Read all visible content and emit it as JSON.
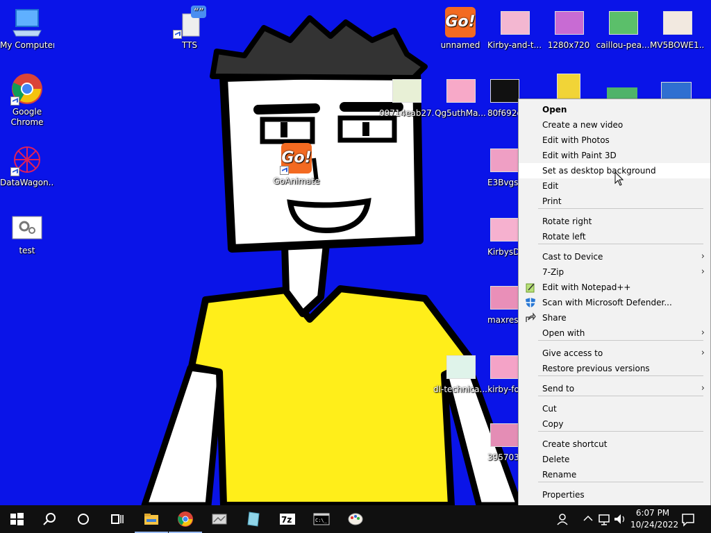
{
  "desktop_icons": [
    {
      "id": "my-computer",
      "label": "My Computer"
    },
    {
      "id": "google-chrome",
      "label": "Google\nChrome"
    },
    {
      "id": "datawagon",
      "label": "DataWagon..."
    },
    {
      "id": "test",
      "label": "test"
    },
    {
      "id": "tts",
      "label": "TTS"
    },
    {
      "id": "goanimate",
      "label": "GoAnimate"
    },
    {
      "id": "0971",
      "label": "09714eab27..."
    },
    {
      "id": "unnamed",
      "label": "unnamed"
    },
    {
      "id": "qg5uth",
      "label": "Qg5uthMa..."
    },
    {
      "id": "80f692",
      "label": "80f692c"
    },
    {
      "id": "kirby-and",
      "label": "Kirby-and-t..."
    },
    {
      "id": "e3bvgs",
      "label": "E3BvgsN"
    },
    {
      "id": "kirbysd",
      "label": "KirbysD"
    },
    {
      "id": "maxres",
      "label": "maxresd"
    },
    {
      "id": "kirby-fo",
      "label": "kirby-fo"
    },
    {
      "id": "3957038",
      "label": "3957038"
    },
    {
      "id": "technica",
      "label": "dl-technica..."
    },
    {
      "id": "1280x720",
      "label": "1280x720"
    },
    {
      "id": "caillou",
      "label": "caillou-pea..."
    },
    {
      "id": "mv5bowe",
      "label": "MV5BOWE1..."
    }
  ],
  "context_menu": {
    "items": [
      {
        "label": "Open"
      },
      {
        "label": "Create a new video"
      },
      {
        "label": "Edit with Photos"
      },
      {
        "label": "Edit with Paint 3D"
      },
      {
        "label": "Set as desktop background"
      },
      {
        "label": "Edit"
      },
      {
        "label": "Print"
      },
      {
        "label": "Rotate right"
      },
      {
        "label": "Rotate left"
      },
      {
        "label": "Cast to Device"
      },
      {
        "label": "7-Zip"
      },
      {
        "label": "Edit with Notepad++"
      },
      {
        "label": "Scan with Microsoft Defender..."
      },
      {
        "label": "Share"
      },
      {
        "label": "Open with"
      },
      {
        "label": "Give access to"
      },
      {
        "label": "Restore previous versions"
      },
      {
        "label": "Send to"
      },
      {
        "label": "Cut"
      },
      {
        "label": "Copy"
      },
      {
        "label": "Create shortcut"
      },
      {
        "label": "Delete"
      },
      {
        "label": "Rename"
      },
      {
        "label": "Properties"
      }
    ]
  },
  "taskbar": {
    "clock_time": "6:07 PM",
    "clock_date": "10/24/2022",
    "icons": [
      "windows-start-icon",
      "search-icon",
      "cortana-icon",
      "task-view-icon",
      "file-explorer-icon",
      "chrome-icon",
      "app-icon",
      "notepad-app-icon",
      "7zip-icon",
      "command-prompt-icon",
      "paint-app-icon"
    ]
  },
  "colors": {
    "desktop": "#0a14e8",
    "taskbar": "#101010",
    "menu": "#f2f2f2",
    "shirt": "#ffee1a",
    "go_orange": "#f36a21"
  }
}
